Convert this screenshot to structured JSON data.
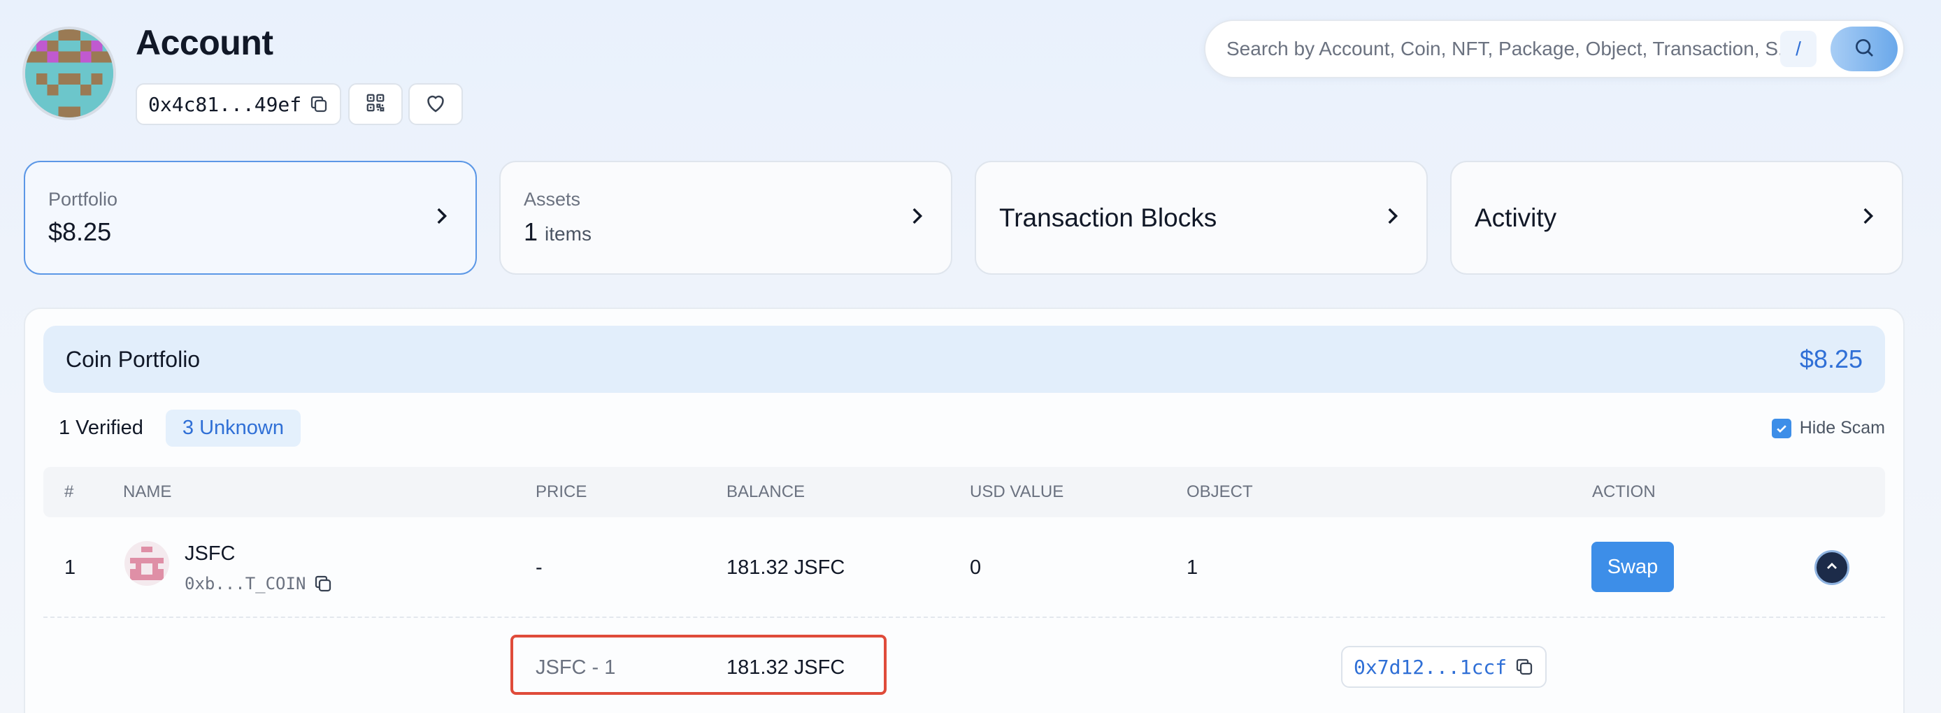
{
  "header": {
    "title": "Account",
    "address_short": "0x4c81...49ef"
  },
  "search": {
    "placeholder": "Search by Account, Coin, NFT, Package, Object, Transaction, S...",
    "shortcut": "/"
  },
  "cards": {
    "portfolio": {
      "label": "Portfolio",
      "value": "$8.25"
    },
    "assets": {
      "label": "Assets",
      "count": "1",
      "unit": "items"
    },
    "transaction_blocks": {
      "label": "Transaction Blocks"
    },
    "activity": {
      "label": "Activity"
    }
  },
  "coin_portfolio": {
    "title": "Coin Portfolio",
    "total": "$8.25",
    "filters": {
      "verified": "1 Verified",
      "unknown": "3 Unknown"
    },
    "hide_scam_label": "Hide Scam",
    "hide_scam_checked": true,
    "columns": [
      "#",
      "NAME",
      "PRICE",
      "BALANCE",
      "USD VALUE",
      "OBJECT",
      "ACTION"
    ],
    "rows": [
      {
        "index": "1",
        "name": "JSFC",
        "coin_type_short": "0xb...T_COIN",
        "price": "-",
        "balance": "181.32 JSFC",
        "usd_value": "0",
        "object": "1",
        "action_label": "Swap"
      }
    ],
    "expanded_object": {
      "label": "JSFC - 1",
      "balance": "181.32 JSFC",
      "object_id_short": "0x7d12...1ccf"
    }
  },
  "colors": {
    "accent": "#3d8ee8",
    "accent_text": "#2f6fd6",
    "highlight": "#df4b3a",
    "header_bg": "#e2eefb"
  }
}
